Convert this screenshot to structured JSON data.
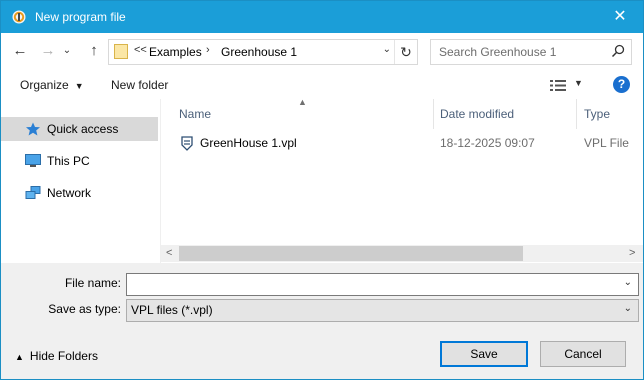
{
  "window": {
    "title": "New program file",
    "close_glyph": "✕"
  },
  "nav": {
    "back_glyph": "←",
    "forward_glyph": "→",
    "recent_glyph": "⌄",
    "up_glyph": "↑",
    "breadcrumb_chevron": "<<",
    "breadcrumbs": [
      "Examples",
      "Greenhouse 1"
    ],
    "refresh_glyph": "↻",
    "search_placeholder": "Search Greenhouse 1"
  },
  "toolbar": {
    "organize_label": "Organize",
    "new_folder_label": "New folder",
    "help_glyph": "?"
  },
  "sidebar": {
    "items": [
      {
        "label": "Quick access",
        "icon": "star-icon",
        "selected": true
      },
      {
        "label": "This PC",
        "icon": "computer-icon",
        "selected": false
      },
      {
        "label": "Network",
        "icon": "network-icon",
        "selected": false
      }
    ]
  },
  "files": {
    "columns": [
      "Name",
      "Date modified",
      "Type"
    ],
    "rows": [
      {
        "name": "GreenHouse 1.vpl",
        "date_modified": "18-12-2025 09:07",
        "type": "VPL File",
        "icon": "vpl-file-icon"
      }
    ]
  },
  "footer": {
    "file_name_label": "File name:",
    "file_name_value": "",
    "save_as_type_label": "Save as type:",
    "save_as_type_value": "VPL files (*.vpl)",
    "hide_folders_label": "Hide Folders",
    "save_label": "Save",
    "cancel_label": "Cancel"
  },
  "colors": {
    "titlebar": "#1b9ed8",
    "selection": "#d9d9d9",
    "accent": "#0078d7"
  }
}
